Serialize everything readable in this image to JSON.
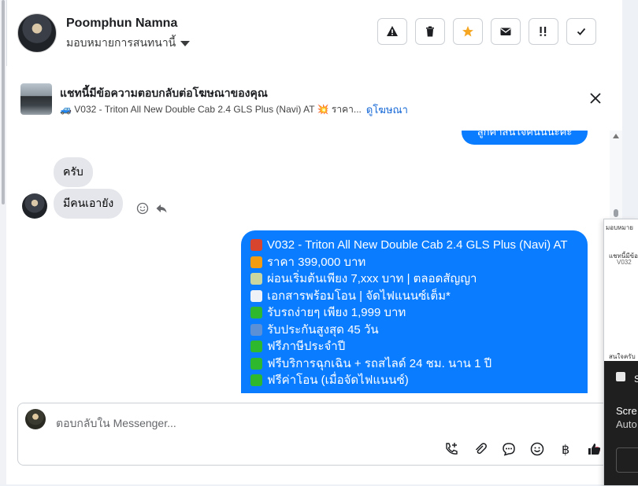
{
  "header": {
    "name": "Poomphun Namna",
    "assign_label": "มอบหมายการสนทนานี้",
    "tools": [
      {
        "icon": "warning-icon"
      },
      {
        "icon": "trash-icon"
      },
      {
        "icon": "star-icon",
        "color": "#f5a623"
      },
      {
        "icon": "mail-icon"
      },
      {
        "icon": "priority-icon"
      },
      {
        "icon": "check-icon"
      }
    ]
  },
  "ad_banner": {
    "title": "แชทนี้มีข้อความตอบกลับต่อโฆษณาของคุณ",
    "line": "🚙 V032 - Triton All New Double Cab 2.4 GLS Plus (Navi) AT 💥 ราคา...",
    "link": "ดูโฆษณา"
  },
  "messages": {
    "outgoing_top_partial": "ลูกค้าสนใจคันนี้นะคะ",
    "incoming": [
      "ครับ",
      "มีคนเอายัง"
    ],
    "outgoing_lines": [
      {
        "emoji": "car",
        "text": "V032 - Triton All New Double Cab 2.4 GLS Plus (Navi) AT"
      },
      {
        "emoji": "boom",
        "text": "ราคา 399,000 บาท"
      },
      {
        "emoji": "money",
        "text": "ผ่อนเริ่มต้นเพียง 7,xxx บาท | ตลอดสัญญา"
      },
      {
        "emoji": "document",
        "text": "เอกสารพร้อมโอน | จัดไฟแนนซ์เต็ม*"
      },
      {
        "emoji": "check",
        "text": "รับรถง่ายๆ เพียง 1,999 บาท"
      },
      {
        "emoji": "shield",
        "text": "รับประกันสูงสุด 45 วัน"
      },
      {
        "emoji": "check",
        "text": "ฟรีภาษีประจำปี"
      },
      {
        "emoji": "check",
        "text": "ฟรีบริการฉุกเฉิน + รถสไลด์ 24 ชม. นาน 1 ปี"
      },
      {
        "emoji": "check",
        "text": "ฟรีค่าโอน (เมื่อจัดไฟแนนซ์)"
      }
    ]
  },
  "composer": {
    "placeholder": "ตอบกลับใน Messenger..."
  },
  "overlay": {
    "tiny_1": "มอบหมาย",
    "tiny_2": "แชทนี้มีข้อค",
    "tiny_3": "V032",
    "tiny_4": "สนใจครับ",
    "s_letter": "S",
    "text_1": "Scre",
    "text_2": "Auto"
  },
  "colors": {
    "accent": "#0a7cff",
    "link": "#1467d6",
    "star": "#f5a623",
    "check_emoji": "#2eb82e"
  }
}
